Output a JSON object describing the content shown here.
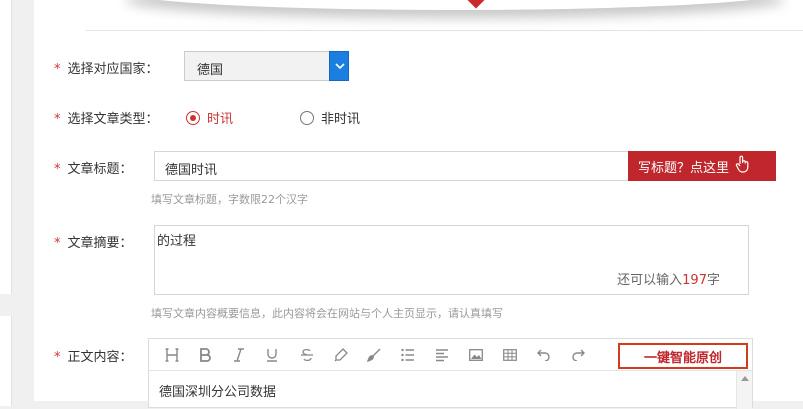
{
  "form": {
    "country": {
      "required_mark": "*",
      "label": "选择对应国家：",
      "value": "德国"
    },
    "article_type": {
      "required_mark": "*",
      "label": "选择文章类型：",
      "options": [
        {
          "label": "时讯",
          "selected": true
        },
        {
          "label": "非时讯",
          "selected": false
        }
      ]
    },
    "title": {
      "required_mark": "*",
      "label": "文章标题：",
      "value": "德国时讯",
      "button_label": "写标题？点这里",
      "hint": "填写文章标题，字数限22个汉字"
    },
    "summary": {
      "required_mark": "*",
      "label": "文章摘要：",
      "value": "的过程",
      "counter_prefix": "还可以输入",
      "counter_value": "197",
      "counter_suffix": "字",
      "hint": "填写文章内容概要信息，此内容将会在网站与个人主页显示，请认真填写"
    },
    "body": {
      "required_mark": "*",
      "label": "正文内容：",
      "toolbar": [
        "heading-icon",
        "bold-icon",
        "italic-icon",
        "underline-icon",
        "strikethrough-icon",
        "highlighter-icon",
        "brush-icon",
        "list-icon",
        "align-left-icon",
        "image-icon",
        "table-icon",
        "undo-icon",
        "redo-icon"
      ],
      "smart_button_label": "一键智能原创",
      "content": "德国深圳分公司数据"
    }
  },
  "colors": {
    "accent": "#c0272d",
    "select_arrow": "#1a7fe0",
    "hint": "#999999"
  }
}
